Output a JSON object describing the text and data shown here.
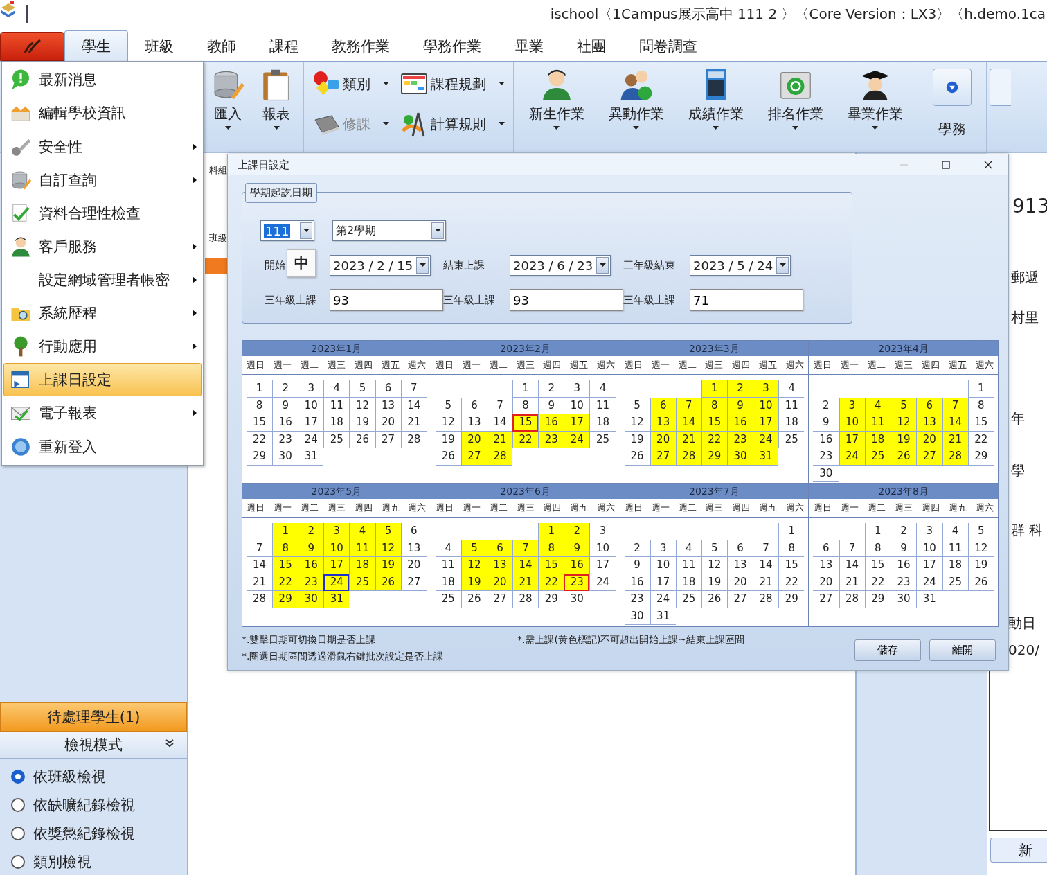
{
  "window": {
    "title": "ischool〈1Campus展示高中 111 2 〉〈Core Version：LX3〉〈h.demo.1ca"
  },
  "tabs": [
    {
      "label": "學生",
      "selected": true
    },
    {
      "label": "班級",
      "selected": false
    },
    {
      "label": "教師",
      "selected": false
    },
    {
      "label": "課程",
      "selected": false
    },
    {
      "label": "教務作業",
      "selected": false
    },
    {
      "label": "學務作業",
      "selected": false
    },
    {
      "label": "畢業",
      "selected": false
    },
    {
      "label": "社團",
      "selected": false
    },
    {
      "label": "問卷調查",
      "selected": false
    }
  ],
  "ribbon": {
    "groups": [
      {
        "kind": "large",
        "buttons": [
          {
            "label": "匯入",
            "dropdown": true,
            "disabled": false
          },
          {
            "label": "報表",
            "dropdown": true,
            "disabled": false
          }
        ]
      },
      {
        "kind": "small",
        "buttons": [
          {
            "label": "類別",
            "dropdown": true,
            "disabled": false
          },
          {
            "label": "修課",
            "dropdown": true,
            "disabled": true
          },
          {
            "label": "課程規劃",
            "dropdown": true,
            "disabled": false
          },
          {
            "label": "計算規則",
            "dropdown": true,
            "disabled": false
          }
        ]
      },
      {
        "kind": "large",
        "buttons": [
          {
            "label": "新生作業",
            "dropdown": true,
            "disabled": false
          },
          {
            "label": "異動作業",
            "dropdown": true,
            "disabled": false
          },
          {
            "label": "成績作業",
            "dropdown": true,
            "disabled": false
          },
          {
            "label": "排名作業",
            "dropdown": true,
            "disabled": false
          },
          {
            "label": "畢業作業",
            "dropdown": true,
            "disabled": false
          }
        ]
      },
      {
        "kind": "square",
        "buttons": [
          {
            "label": "學務",
            "dropdown": false,
            "disabled": false
          }
        ]
      }
    ]
  },
  "app_menu": {
    "items": [
      {
        "label": "最新消息",
        "submenu": false,
        "selected": false,
        "divider_after": false
      },
      {
        "label": "編輯學校資訊",
        "submenu": false,
        "selected": false,
        "divider_after": true
      },
      {
        "label": "安全性",
        "submenu": true,
        "selected": false,
        "divider_after": false
      },
      {
        "label": "自訂查詢",
        "submenu": true,
        "selected": false,
        "divider_after": false
      },
      {
        "label": "資料合理性檢查",
        "submenu": false,
        "selected": false,
        "divider_after": false
      },
      {
        "label": "客戶服務",
        "submenu": true,
        "selected": false,
        "divider_after": false
      },
      {
        "label": "設定網域管理者帳密",
        "submenu": true,
        "selected": false,
        "divider_after": false
      },
      {
        "label": "系統歷程",
        "submenu": true,
        "selected": false,
        "divider_after": false
      },
      {
        "label": "行動應用",
        "submenu": true,
        "selected": false,
        "divider_after": false
      },
      {
        "label": "上課日設定",
        "submenu": false,
        "selected": true,
        "divider_after": false
      },
      {
        "label": "電子報表",
        "submenu": true,
        "selected": false,
        "divider_after": true
      },
      {
        "label": "重新登入",
        "submenu": false,
        "selected": false,
        "divider_after": false
      }
    ]
  },
  "side_strip": {
    "labels": [
      "料組",
      "班級"
    ]
  },
  "sidebar": {
    "pending": "待處理學生(1)",
    "view_mode": {
      "title": "檢視模式",
      "options": [
        {
          "label": "依班級檢視",
          "selected": true
        },
        {
          "label": "依缺曠紀錄檢視",
          "selected": false
        },
        {
          "label": "依獎懲紀錄檢視",
          "selected": false
        },
        {
          "label": "類別檢視",
          "selected": false
        }
      ]
    }
  },
  "detail_panel": {
    "student_number": "913",
    "labels": [
      "郵遞",
      "村里",
      "年",
      "學",
      "群 科"
    ],
    "history_label": "動日",
    "history_date": "020/",
    "add_button": "新"
  },
  "dialog": {
    "title": "上課日設定",
    "group_title": "學期起訖日期",
    "school_year": "111",
    "semester": "第2學期",
    "ime_indicator": "中",
    "date_fields": [
      {
        "label": "開始",
        "value": "2023 / 2 / 15"
      },
      {
        "label": "結束上課",
        "value": "2023 / 6 / 23"
      },
      {
        "label": "三年級結束",
        "value": "2023 / 5 / 24"
      }
    ],
    "count_fields": [
      {
        "label": "三年級上課",
        "value": "93"
      },
      {
        "label": "三年級上課",
        "value": "93"
      },
      {
        "label": "三年級上課",
        "value": "71"
      }
    ],
    "calendars": [
      {
        "title": "2023年1月",
        "weekdays": [
          "週日",
          "週一",
          "週二",
          "週三",
          "週四",
          "週五",
          "週六"
        ],
        "weeks": [
          {
            "days": [
              {
                "day": "1",
                "school_day": false
              },
              {
                "day": "2",
                "school_day": false
              },
              {
                "day": "3",
                "school_day": false
              },
              {
                "day": "4",
                "school_day": false
              },
              {
                "day": "5",
                "school_day": false
              },
              {
                "day": "6",
                "school_day": false
              },
              {
                "day": "7",
                "school_day": false
              }
            ]
          },
          {
            "days": [
              {
                "day": "8",
                "school_day": false
              },
              {
                "day": "9",
                "school_day": false
              },
              {
                "day": "10",
                "school_day": false
              },
              {
                "day": "11",
                "school_day": false
              },
              {
                "day": "12",
                "school_day": false
              },
              {
                "day": "13",
                "school_day": false
              },
              {
                "day": "14",
                "school_day": false
              }
            ]
          },
          {
            "days": [
              {
                "day": "15",
                "school_day": false
              },
              {
                "day": "16",
                "school_day": false
              },
              {
                "day": "17",
                "school_day": false
              },
              {
                "day": "18",
                "school_day": false
              },
              {
                "day": "19",
                "school_day": false
              },
              {
                "day": "20",
                "school_day": false
              },
              {
                "day": "21",
                "school_day": false
              }
            ]
          },
          {
            "days": [
              {
                "day": "22",
                "school_day": false
              },
              {
                "day": "23",
                "school_day": false
              },
              {
                "day": "24",
                "school_day": false
              },
              {
                "day": "25",
                "school_day": false
              },
              {
                "day": "26",
                "school_day": false
              },
              {
                "day": "27",
                "school_day": false
              },
              {
                "day": "28",
                "school_day": false
              }
            ]
          },
          {
            "days": [
              {
                "day": "29",
                "school_day": false
              },
              {
                "day": "30",
                "school_day": false
              },
              {
                "day": "31",
                "school_day": false
              }
            ]
          }
        ]
      },
      {
        "title": "2023年2月",
        "weekdays": [
          "週日",
          "週一",
          "週二",
          "週三",
          "週四",
          "週五",
          "週六"
        ],
        "weeks": [
          {
            "days": [
              {
                "day": "1",
                "school_day": false
              },
              {
                "day": "2",
                "school_day": false
              },
              {
                "day": "3",
                "school_day": false
              },
              {
                "day": "4",
                "school_day": false
              }
            ]
          },
          {
            "days": [
              {
                "day": "5",
                "school_day": false
              },
              {
                "day": "6",
                "school_day": false
              },
              {
                "day": "7",
                "school_day": false
              },
              {
                "day": "8",
                "school_day": false
              },
              {
                "day": "9",
                "school_day": false
              },
              {
                "day": "10",
                "school_day": false
              },
              {
                "day": "11",
                "school_day": false
              }
            ]
          },
          {
            "days": [
              {
                "day": "12",
                "school_day": false
              },
              {
                "day": "13",
                "school_day": false
              },
              {
                "day": "14",
                "school_day": false
              },
              {
                "day": "15",
                "school_day": true,
                "color": "#e02020"
              },
              {
                "day": "16",
                "school_day": true
              },
              {
                "day": "17",
                "school_day": true
              },
              {
                "day": "18",
                "school_day": false
              }
            ]
          },
          {
            "days": [
              {
                "day": "19",
                "school_day": false
              },
              {
                "day": "20",
                "school_day": true
              },
              {
                "day": "21",
                "school_day": true
              },
              {
                "day": "22",
                "school_day": true
              },
              {
                "day": "23",
                "school_day": true
              },
              {
                "day": "24",
                "school_day": true
              },
              {
                "day": "25",
                "school_day": false
              }
            ]
          },
          {
            "days": [
              {
                "day": "26",
                "school_day": false
              },
              {
                "day": "27",
                "school_day": true
              },
              {
                "day": "28",
                "school_day": true
              }
            ]
          }
        ]
      },
      {
        "title": "2023年3月",
        "weekdays": [
          "週日",
          "週一",
          "週二",
          "週三",
          "週四",
          "週五",
          "週六"
        ],
        "weeks": [
          {
            "days": [
              {
                "day": "1",
                "school_day": true
              },
              {
                "day": "2",
                "school_day": true
              },
              {
                "day": "3",
                "school_day": true
              },
              {
                "day": "4",
                "school_day": false
              }
            ]
          },
          {
            "days": [
              {
                "day": "5",
                "school_day": false
              },
              {
                "day": "6",
                "school_day": true
              },
              {
                "day": "7",
                "school_day": true
              },
              {
                "day": "8",
                "school_day": true
              },
              {
                "day": "9",
                "school_day": true
              },
              {
                "day": "10",
                "school_day": true
              },
              {
                "day": "11",
                "school_day": false
              }
            ]
          },
          {
            "days": [
              {
                "day": "12",
                "school_day": false
              },
              {
                "day": "13",
                "school_day": true
              },
              {
                "day": "14",
                "school_day": true
              },
              {
                "day": "15",
                "school_day": true
              },
              {
                "day": "16",
                "school_day": true
              },
              {
                "day": "17",
                "school_day": true
              },
              {
                "day": "18",
                "school_day": false
              }
            ]
          },
          {
            "days": [
              {
                "day": "19",
                "school_day": false
              },
              {
                "day": "20",
                "school_day": true
              },
              {
                "day": "21",
                "school_day": true
              },
              {
                "day": "22",
                "school_day": true
              },
              {
                "day": "23",
                "school_day": true
              },
              {
                "day": "24",
                "school_day": true
              },
              {
                "day": "25",
                "school_day": false
              }
            ]
          },
          {
            "days": [
              {
                "day": "26",
                "school_day": false
              },
              {
                "day": "27",
                "school_day": true
              },
              {
                "day": "28",
                "school_day": true
              },
              {
                "day": "29",
                "school_day": true
              },
              {
                "day": "30",
                "school_day": true
              },
              {
                "day": "31",
                "school_day": true
              }
            ]
          }
        ]
      },
      {
        "title": "2023年4月",
        "weekdays": [
          "週日",
          "週一",
          "週二",
          "週三",
          "週四",
          "週五",
          "週六"
        ],
        "weeks": [
          {
            "days": [
              {
                "day": "1",
                "school_day": false
              }
            ]
          },
          {
            "days": [
              {
                "day": "2",
                "school_day": false
              },
              {
                "day": "3",
                "school_day": true
              },
              {
                "day": "4",
                "school_day": true
              },
              {
                "day": "5",
                "school_day": true
              },
              {
                "day": "6",
                "school_day": true
              },
              {
                "day": "7",
                "school_day": true
              },
              {
                "day": "8",
                "school_day": false
              }
            ]
          },
          {
            "days": [
              {
                "day": "9",
                "school_day": false
              },
              {
                "day": "10",
                "school_day": true
              },
              {
                "day": "11",
                "school_day": true
              },
              {
                "day": "12",
                "school_day": true
              },
              {
                "day": "13",
                "school_day": true
              },
              {
                "day": "14",
                "school_day": true
              },
              {
                "day": "15",
                "school_day": false
              }
            ]
          },
          {
            "days": [
              {
                "day": "16",
                "school_day": false
              },
              {
                "day": "17",
                "school_day": true
              },
              {
                "day": "18",
                "school_day": true
              },
              {
                "day": "19",
                "school_day": true
              },
              {
                "day": "20",
                "school_day": true
              },
              {
                "day": "21",
                "school_day": true
              },
              {
                "day": "22",
                "school_day": false
              }
            ]
          },
          {
            "days": [
              {
                "day": "23",
                "school_day": false
              },
              {
                "day": "24",
                "school_day": true
              },
              {
                "day": "25",
                "school_day": true
              },
              {
                "day": "26",
                "school_day": true
              },
              {
                "day": "27",
                "school_day": true
              },
              {
                "day": "28",
                "school_day": true
              },
              {
                "day": "29",
                "school_day": false
              }
            ]
          },
          {
            "days": [
              {
                "day": "30",
                "school_day": false
              }
            ]
          }
        ]
      },
      {
        "title": "2023年5月",
        "weekdays": [
          "週日",
          "週一",
          "週二",
          "週三",
          "週四",
          "週五",
          "週六"
        ],
        "weeks": [
          {
            "days": [
              {
                "day": "1",
                "school_day": true
              },
              {
                "day": "2",
                "school_day": true
              },
              {
                "day": "3",
                "school_day": true
              },
              {
                "day": "4",
                "school_day": true
              },
              {
                "day": "5",
                "school_day": true
              },
              {
                "day": "6",
                "school_day": false
              }
            ]
          },
          {
            "days": [
              {
                "day": "7",
                "school_day": false
              },
              {
                "day": "8",
                "school_day": true
              },
              {
                "day": "9",
                "school_day": true
              },
              {
                "day": "10",
                "school_day": true
              },
              {
                "day": "11",
                "school_day": true
              },
              {
                "day": "12",
                "school_day": true
              },
              {
                "day": "13",
                "school_day": false
              }
            ]
          },
          {
            "days": [
              {
                "day": "14",
                "school_day": false
              },
              {
                "day": "15",
                "school_day": true
              },
              {
                "day": "16",
                "school_day": true
              },
              {
                "day": "17",
                "school_day": true
              },
              {
                "day": "18",
                "school_day": true
              },
              {
                "day": "19",
                "school_day": true
              },
              {
                "day": "20",
                "school_day": false
              }
            ]
          },
          {
            "days": [
              {
                "day": "21",
                "school_day": false
              },
              {
                "day": "22",
                "school_day": true
              },
              {
                "day": "23",
                "school_day": true
              },
              {
                "day": "24",
                "school_day": true,
                "color": "#2030d0"
              },
              {
                "day": "25",
                "school_day": true
              },
              {
                "day": "26",
                "school_day": true
              },
              {
                "day": "27",
                "school_day": false
              }
            ]
          },
          {
            "days": [
              {
                "day": "28",
                "school_day": false
              },
              {
                "day": "29",
                "school_day": true
              },
              {
                "day": "30",
                "school_day": true
              },
              {
                "day": "31",
                "school_day": true
              }
            ]
          }
        ]
      },
      {
        "title": "2023年6月",
        "weekdays": [
          "週日",
          "週一",
          "週二",
          "週三",
          "週四",
          "週五",
          "週六"
        ],
        "weeks": [
          {
            "days": [
              {
                "day": "1",
                "school_day": true
              },
              {
                "day": "2",
                "school_day": true
              },
              {
                "day": "3",
                "school_day": false
              }
            ]
          },
          {
            "days": [
              {
                "day": "4",
                "school_day": false
              },
              {
                "day": "5",
                "school_day": true
              },
              {
                "day": "6",
                "school_day": true
              },
              {
                "day": "7",
                "school_day": true
              },
              {
                "day": "8",
                "school_day": true
              },
              {
                "day": "9",
                "school_day": true
              },
              {
                "day": "10",
                "school_day": false
              }
            ]
          },
          {
            "days": [
              {
                "day": "11",
                "school_day": false
              },
              {
                "day": "12",
                "school_day": true
              },
              {
                "day": "13",
                "school_day": true
              },
              {
                "day": "14",
                "school_day": true
              },
              {
                "day": "15",
                "school_day": true
              },
              {
                "day": "16",
                "school_day": true
              },
              {
                "day": "17",
                "school_day": false
              }
            ]
          },
          {
            "days": [
              {
                "day": "18",
                "school_day": false
              },
              {
                "day": "19",
                "school_day": true
              },
              {
                "day": "20",
                "school_day": true
              },
              {
                "day": "21",
                "school_day": true
              },
              {
                "day": "22",
                "school_day": true
              },
              {
                "day": "23",
                "school_day": true,
                "color": "#e02020"
              },
              {
                "day": "24",
                "school_day": false
              }
            ]
          },
          {
            "days": [
              {
                "day": "25",
                "school_day": false
              },
              {
                "day": "26",
                "school_day": false
              },
              {
                "day": "27",
                "school_day": false
              },
              {
                "day": "28",
                "school_day": false
              },
              {
                "day": "29",
                "school_day": false
              },
              {
                "day": "30",
                "school_day": false
              }
            ]
          }
        ]
      },
      {
        "title": "2023年7月",
        "weekdays": [
          "週日",
          "週一",
          "週二",
          "週三",
          "週四",
          "週五",
          "週六"
        ],
        "weeks": [
          {
            "days": [
              {
                "day": "1",
                "school_day": false
              }
            ]
          },
          {
            "days": [
              {
                "day": "2",
                "school_day": false
              },
              {
                "day": "3",
                "school_day": false
              },
              {
                "day": "4",
                "school_day": false
              },
              {
                "day": "5",
                "school_day": false
              },
              {
                "day": "6",
                "school_day": false
              },
              {
                "day": "7",
                "school_day": false
              },
              {
                "day": "8",
                "school_day": false
              }
            ]
          },
          {
            "days": [
              {
                "day": "9",
                "school_day": false
              },
              {
                "day": "10",
                "school_day": false
              },
              {
                "day": "11",
                "school_day": false
              },
              {
                "day": "12",
                "school_day": false
              },
              {
                "day": "13",
                "school_day": false
              },
              {
                "day": "14",
                "school_day": false
              },
              {
                "day": "15",
                "school_day": false
              }
            ]
          },
          {
            "days": [
              {
                "day": "16",
                "school_day": false
              },
              {
                "day": "17",
                "school_day": false
              },
              {
                "day": "18",
                "school_day": false
              },
              {
                "day": "19",
                "school_day": false
              },
              {
                "day": "20",
                "school_day": false
              },
              {
                "day": "21",
                "school_day": false
              },
              {
                "day": "22",
                "school_day": false
              }
            ]
          },
          {
            "days": [
              {
                "day": "23",
                "school_day": false
              },
              {
                "day": "24",
                "school_day": false
              },
              {
                "day": "25",
                "school_day": false
              },
              {
                "day": "26",
                "school_day": false
              },
              {
                "day": "27",
                "school_day": false
              },
              {
                "day": "28",
                "school_day": false
              },
              {
                "day": "29",
                "school_day": false
              }
            ]
          },
          {
            "days": [
              {
                "day": "30",
                "school_day": false
              },
              {
                "day": "31",
                "school_day": false
              }
            ]
          }
        ]
      },
      {
        "title": "2023年8月",
        "weekdays": [
          "週日",
          "週一",
          "週二",
          "週三",
          "週四",
          "週五",
          "週六"
        ],
        "weeks": [
          {
            "days": [
              {
                "day": "1",
                "school_day": false
              },
              {
                "day": "2",
                "school_day": false
              },
              {
                "day": "3",
                "school_day": false
              },
              {
                "day": "4",
                "school_day": false
              },
              {
                "day": "5",
                "school_day": false
              }
            ]
          },
          {
            "days": [
              {
                "day": "6",
                "school_day": false
              },
              {
                "day": "7",
                "school_day": false
              },
              {
                "day": "8",
                "school_day": false
              },
              {
                "day": "9",
                "school_day": false
              },
              {
                "day": "10",
                "school_day": false
              },
              {
                "day": "11",
                "school_day": false
              },
              {
                "day": "12",
                "school_day": false
              }
            ]
          },
          {
            "days": [
              {
                "day": "13",
                "school_day": false
              },
              {
                "day": "14",
                "school_day": false
              },
              {
                "day": "15",
                "school_day": false
              },
              {
                "day": "16",
                "school_day": false
              },
              {
                "day": "17",
                "school_day": false
              },
              {
                "day": "18",
                "school_day": false
              },
              {
                "day": "19",
                "school_day": false
              }
            ]
          },
          {
            "days": [
              {
                "day": "20",
                "school_day": false
              },
              {
                "day": "21",
                "school_day": false
              },
              {
                "day": "22",
                "school_day": false
              },
              {
                "day": "23",
                "school_day": false
              },
              {
                "day": "24",
                "school_day": false
              },
              {
                "day": "25",
                "school_day": false
              },
              {
                "day": "26",
                "school_day": false
              }
            ]
          },
          {
            "days": [
              {
                "day": "27",
                "school_day": false
              },
              {
                "day": "28",
                "school_day": false
              },
              {
                "day": "29",
                "school_day": false
              },
              {
                "day": "30",
                "school_day": false
              },
              {
                "day": "31",
                "school_day": false
              }
            ]
          }
        ]
      }
    ],
    "notes": [
      "*.雙擊日期可切換日期是否上課",
      "*.圈選日期區間透過滑鼠右鍵批次設定是否上課"
    ],
    "rule_note": "*.需上課(黃色標記)不可超出開始上課~結束上課區間",
    "buttons": [
      "儲存",
      "離開"
    ]
  }
}
